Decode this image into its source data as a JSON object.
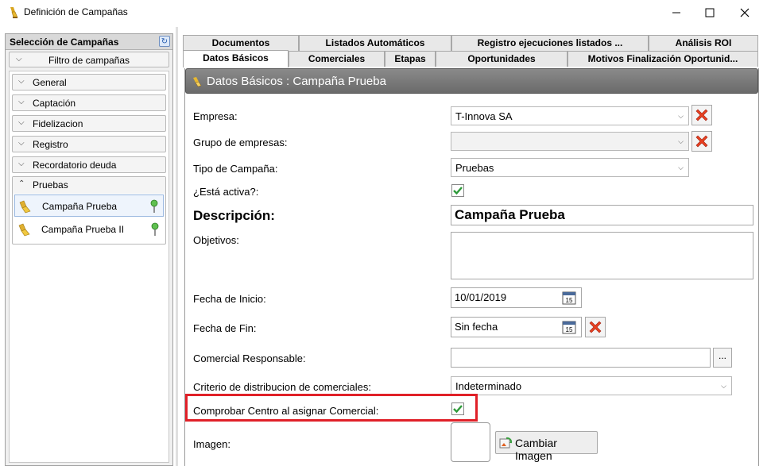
{
  "window": {
    "title": "Definición de Campañas"
  },
  "left_panel": {
    "title": "Selección de Campañas",
    "filter_label": "Filtro de campañas",
    "groups": [
      {
        "label": "General"
      },
      {
        "label": "Captación"
      },
      {
        "label": "Fidelizacion"
      },
      {
        "label": "Registro"
      },
      {
        "label": "Recordatorio deuda"
      }
    ],
    "open_group": {
      "label": "Pruebas",
      "items": [
        {
          "label": "Campaña Prueba",
          "selected": true
        },
        {
          "label": "Campaña Prueba II",
          "selected": false
        }
      ]
    }
  },
  "tabs": {
    "row_back": [
      {
        "label": "Documentos"
      },
      {
        "label": "Listados Automáticos"
      },
      {
        "label": "Registro ejecuciones listados ..."
      },
      {
        "label": "Análisis ROI"
      }
    ],
    "row_front": [
      {
        "label": "Datos Básicos",
        "active": true
      },
      {
        "label": "Comerciales"
      },
      {
        "label": "Etapas"
      },
      {
        "label": "Oportunidades"
      },
      {
        "label": "Motivos Finalización Oportunid..."
      }
    ]
  },
  "form": {
    "header": "Datos Básicos : Campaña Prueba",
    "empresa": {
      "label": "Empresa:",
      "value": "T-Innova SA"
    },
    "grupo": {
      "label": "Grupo de empresas:",
      "value": ""
    },
    "tipo": {
      "label": "Tipo de Campaña:",
      "value": "Pruebas"
    },
    "activa": {
      "label": "¿Está activa?:",
      "checked": true
    },
    "descripcion": {
      "label": "Descripción:",
      "value": "Campaña Prueba"
    },
    "objetivos": {
      "label": "Objetivos:",
      "value": ""
    },
    "fecha_inicio": {
      "label": "Fecha de Inicio:",
      "value": "10/01/2019"
    },
    "fecha_fin": {
      "label": "Fecha de Fin:",
      "value": "Sin fecha"
    },
    "comercial": {
      "label": "Comercial Responsable:",
      "value": "",
      "button": "..."
    },
    "criterio": {
      "label": "Criterio de distribucion de comerciales:",
      "value": "Indeterminado"
    },
    "comprobar": {
      "label": "Comprobar Centro al asignar Comercial:",
      "checked": true
    },
    "imagen": {
      "label": "Imagen:",
      "button": "Cambiar Imagen"
    }
  },
  "colors": {
    "highlight": "#e02028",
    "check": "#2e9a3a",
    "delete_x": "#e84020",
    "header_bg": "#777777"
  }
}
